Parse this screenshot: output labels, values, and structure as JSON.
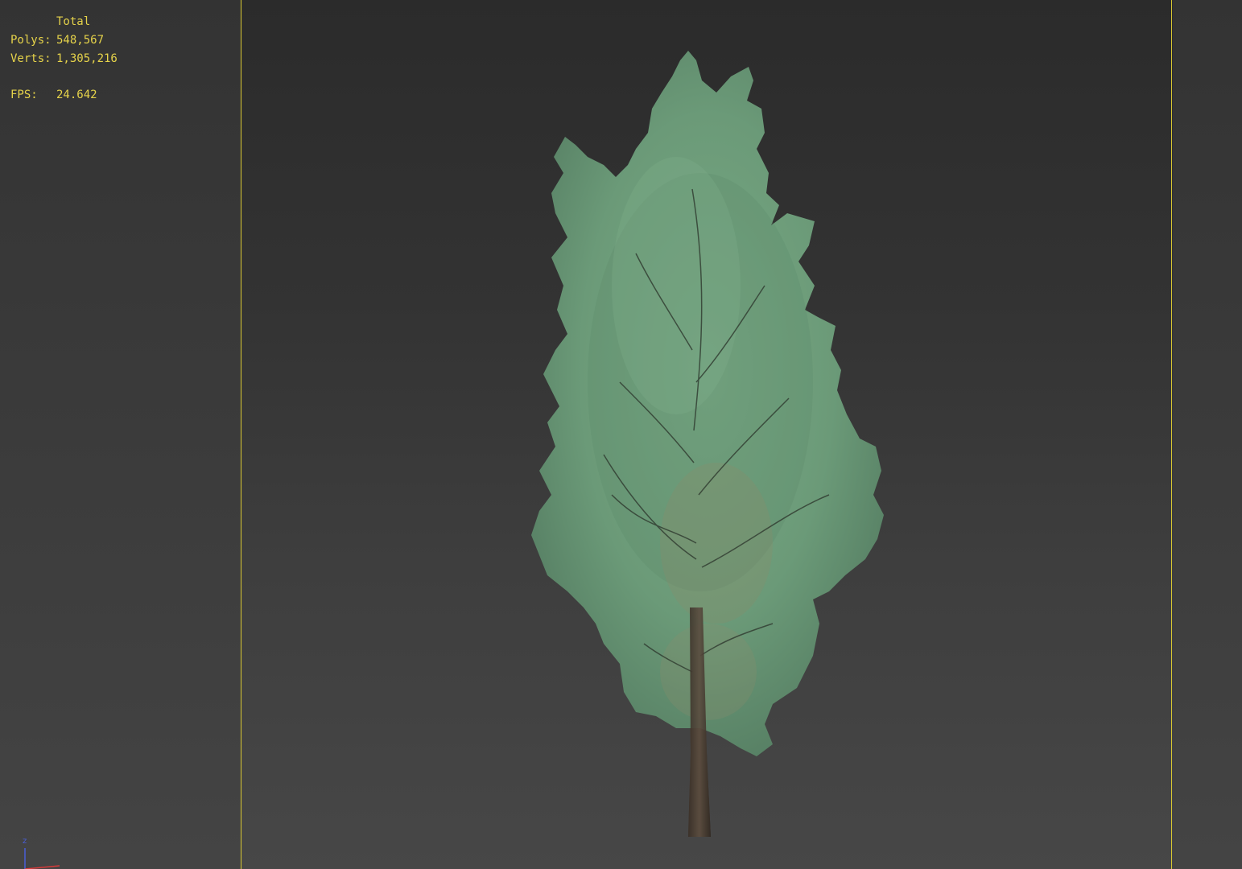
{
  "stats": {
    "header": "Total",
    "polys_label": "Polys:",
    "polys_value": "548,567",
    "verts_label": "Verts:",
    "verts_value": "1,305,216",
    "fps_label": "FPS:",
    "fps_value": "24.642"
  },
  "gizmo": {
    "z_label": "z"
  },
  "colors": {
    "stats_text": "#e6d34a",
    "safe_frame": "#d9c832",
    "foliage": "#6b9a78",
    "trunk": "#4a3f34",
    "axis_z": "#4a5fd8",
    "axis_x": "#d83a3a"
  }
}
